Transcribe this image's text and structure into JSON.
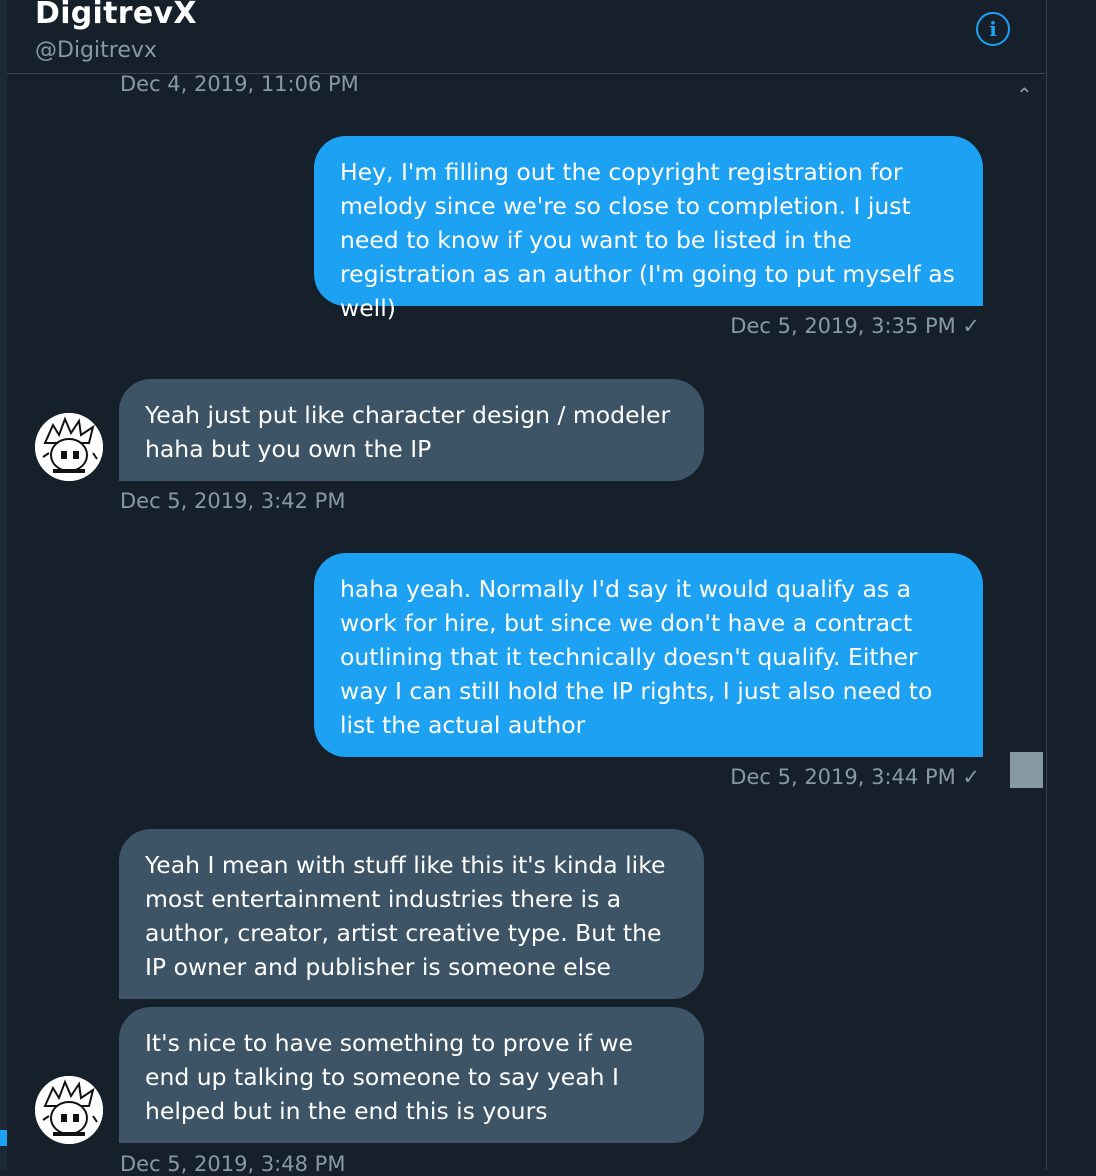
{
  "header": {
    "name": "DigitrevX",
    "handle": "@Digitrevx",
    "info_icon": "i"
  },
  "conversation": {
    "timestamps": [
      "Dec 4, 2019, 11:06 PM",
      "Dec 5, 2019, 3:35 PM ✓",
      "Dec 5, 2019, 3:42 PM",
      "Dec 5, 2019, 3:44 PM ✓",
      "Dec 5, 2019, 3:48 PM"
    ],
    "messages": [
      {
        "direction": "sent",
        "text": "Hey, I'm filling out the copyright registration for melody since we're so close to completion. I just need to know if you want to be listed in the registration as an author (I'm going to put myself as well)"
      },
      {
        "direction": "received",
        "text": "Yeah just put like character design / modeler haha but you own the IP"
      },
      {
        "direction": "sent",
        "text": "haha yeah. Normally I'd say it would qualify as a work for hire, but since we don't have a contract outlining that it technically doesn't qualify. Either way I can still hold the IP rights, I just also need to list the actual author"
      },
      {
        "direction": "received",
        "text": "Yeah I mean with stuff like this it's kinda like most entertainment industries there is a author, creator, artist creative type. But the IP owner and publisher is someone else"
      },
      {
        "direction": "received",
        "text": "It's nice to have something to prove if we end up talking to someone to say yeah I helped but in the end this is yours"
      }
    ]
  },
  "icons": {
    "info": "info-circle-icon",
    "scroll_up": "chevron-up-icon",
    "avatar": "anime-avatar"
  },
  "colors": {
    "background": "#15202b",
    "sent_bubble": "#1da1f2",
    "received_bubble": "#3d5466",
    "muted_text": "#8899a6"
  }
}
